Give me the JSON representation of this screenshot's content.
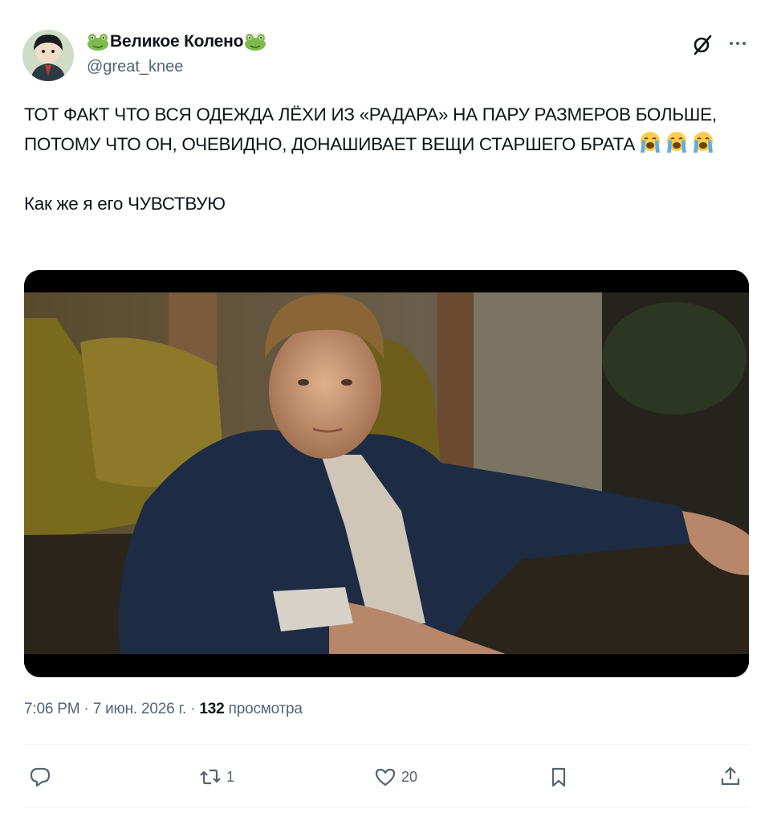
{
  "author": {
    "display_name": "Великое Колено",
    "handle": "@great_knee",
    "name_emoji": "frog-emoji"
  },
  "header_icons": [
    "grok-icon",
    "more-icon"
  ],
  "post": {
    "text_line1": "ТОТ ФАКТ ЧТО ВСЯ ОДЕЖДА ЛЁХИ ИЗ «РАДАРА» НА ПАРУ РАЗМЕРОВ БОЛЬШЕ, ПОТОМУ ЧТО ОН, ОЧЕВИДНО, ДОНАШИВАЕТ ВЕЩИ СТАРШЕГО БРАТА",
    "text_emojis": [
      "loudly-crying-face",
      "loudly-crying-face",
      "loudly-crying-face"
    ],
    "text_line2": "Как же я его ЧУВСТВУЮ",
    "media": "video-still"
  },
  "meta": {
    "time": "7:06 PM",
    "sep1": "·",
    "date": "7 июн. 2026 г.",
    "sep2": "·",
    "views_count": "132",
    "views_label": "просмотра"
  },
  "actions": {
    "reply_count": "",
    "repost_count": "1",
    "like_count": "20",
    "bookmark_count": "",
    "share_count": ""
  },
  "colors": {
    "text": "#0f1419",
    "secondary": "#536471",
    "divider": "#eff3f4"
  }
}
